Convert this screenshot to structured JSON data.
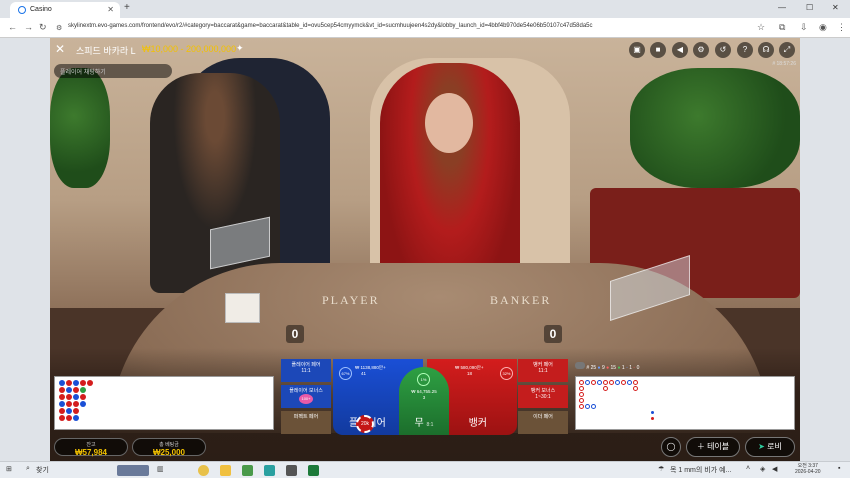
{
  "browser": {
    "tab_title": "Casino",
    "new_tab": "+",
    "url": "skylinextm.evo-games.com/frontend/evo/r2/#category=baccarat&game=baccarat&table_id=ovu5cep54cmyymck&vt_id=sucmhuujeen4s2dy&lobby_launch_id=4bbf4b970de54e06b50107c47d58da5c"
  },
  "game": {
    "title": "스피드 바카라 L",
    "limits": "₩10,000 - 200,000,000",
    "chat_placeholder": "플레이어 채팅하기",
    "round_id": "# 18:57:26",
    "table_player": "PLAYER",
    "table_banker": "BANKER",
    "player_score": "0",
    "banker_score": "0",
    "bets": {
      "player_pair": "플레이어 페어",
      "player_pair_odds": "11:1",
      "player_bonus": "플레이어 보너스",
      "perfect_pair": "퍼펙트 페어",
      "banker_pair": "뱅커 페어",
      "banker_pair_odds": "11:1",
      "banker_bonus": "뱅커 보너스",
      "banker_bonus_odds": "1~30:1",
      "either_pair": "이더 페어",
      "player": "플레이어",
      "player_pct": "67%",
      "player_amount": "₩ 1138,880만+",
      "player_count": "41",
      "tie": "무",
      "tie_odds": "8:1",
      "tie_pct": "1%",
      "tie_amount": "₩ 64,755.25",
      "tie_count": "3",
      "banker": "뱅커",
      "banker_pct": "32%",
      "banker_amount": "₩ 580,090만+",
      "banker_count": "18",
      "chip": "20k",
      "bonus_chip": "100+"
    },
    "balance_label": "잔고",
    "balance": "₩57,984",
    "total_bet_label": "총 베팅금",
    "total_bet": "₩25,000",
    "stats": {
      "rounds": "25",
      "player_wins": "9",
      "banker_wins": "15",
      "ties": "1",
      "player_pairs": "1",
      "banker_pairs": "0"
    },
    "tables_button": "테이블",
    "lobby_button": "로비"
  },
  "taskbar": {
    "search": "찾기",
    "weather": "목 1 mm의 비가 예...",
    "time": "오전 3:37",
    "date": "2026-04-20"
  },
  "colors": {
    "player": "#1a4fd6",
    "banker": "#d41d1d",
    "tie": "#2ea043",
    "gold": "#f3c200"
  }
}
